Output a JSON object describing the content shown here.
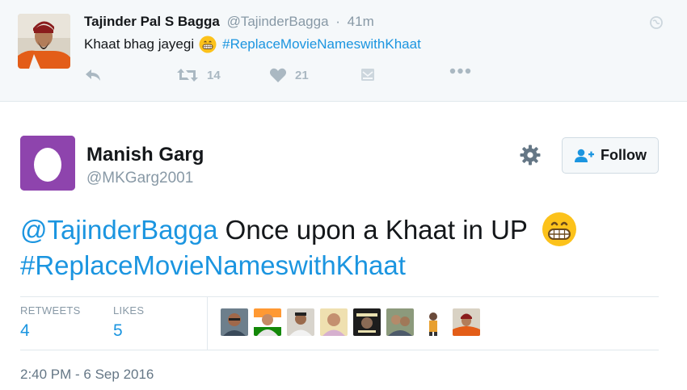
{
  "parent_tweet": {
    "author_name": "Tajinder Pal S Bagga",
    "author_handle": "@TajinderBagga",
    "separator": "·",
    "time_ago": "41m",
    "text_prefix": "Khaat bhag jayegi",
    "hashtag": "#ReplaceMovieNameswithKhaat",
    "emoji": "grinning-face-emoji",
    "actions": {
      "reply_icon": "reply-icon",
      "retweet_icon": "retweet-icon",
      "retweet_count": "14",
      "like_icon": "heart-icon",
      "like_count": "21",
      "dm_icon": "direct-message-icon",
      "more_icon": "more-dots-icon"
    }
  },
  "main_tweet": {
    "author_name": "Manish Garg",
    "author_handle": "@MKGarg2001",
    "follow_label": "Follow",
    "mention": "@TajinderBagga",
    "text_body": " Once upon a Khaat in UP",
    "hashtag": "#ReplaceMovieNameswithKhaat",
    "emoji": "grinning-face-emoji",
    "stats": {
      "retweets_label": "RETWEETS",
      "retweets_value": "4",
      "likes_label": "LIKES",
      "likes_value": "5"
    },
    "timestamp": "2:40 PM - 6 Sep 2016"
  },
  "colors": {
    "link": "#1b95e0",
    "muted": "#8899a6",
    "egg_avatar": "#8e44ad",
    "parent_background": "#f5f8fa"
  }
}
